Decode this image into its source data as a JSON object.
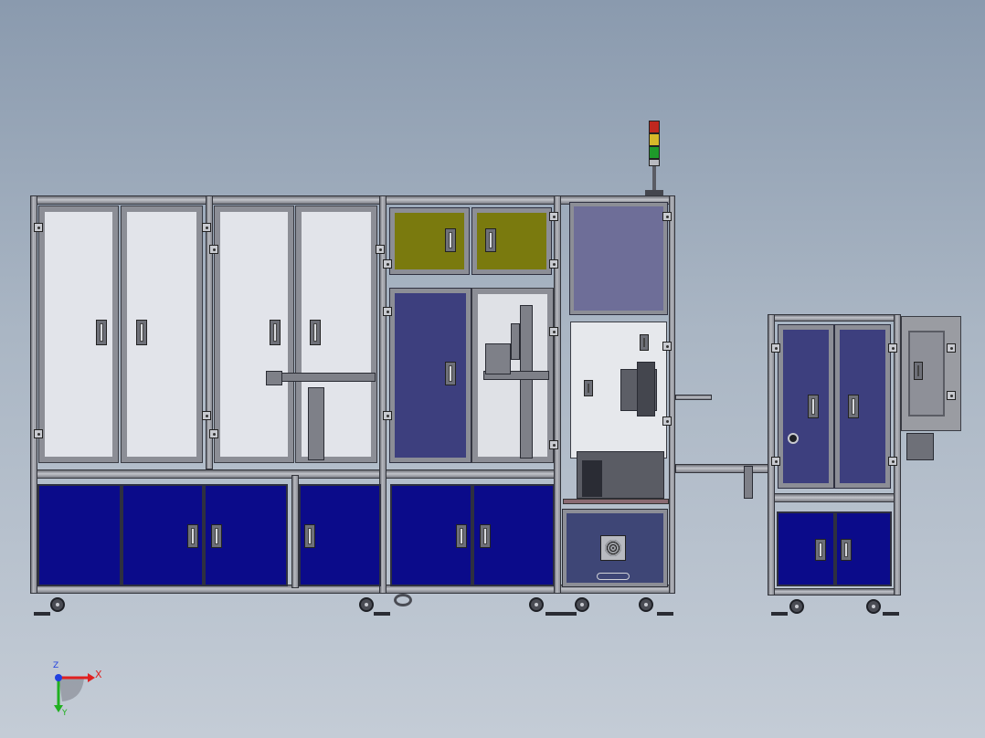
{
  "view": {
    "title": "",
    "background_color": "#9aa6b6",
    "colors": {
      "glass_panel": "#e2e4ea",
      "lower_cabinet_door": "#0b0b8a",
      "navy_door": "#3d3f7e",
      "olive_panel": "#7a7a0e",
      "purple_panel": "#6e6e98",
      "aluminum_frame": "#9a9ca2"
    }
  },
  "signal_tower": {
    "lamps": [
      "red",
      "yellow",
      "green"
    ],
    "lamp_colors": [
      "#c0281e",
      "#d6b82a",
      "#1e9a2a"
    ]
  },
  "triad": {
    "x_label": "X",
    "y_label": "Y",
    "z_label": "Z",
    "x_color": "#e02020",
    "y_color": "#20b020",
    "z_color": "#2040e0"
  }
}
